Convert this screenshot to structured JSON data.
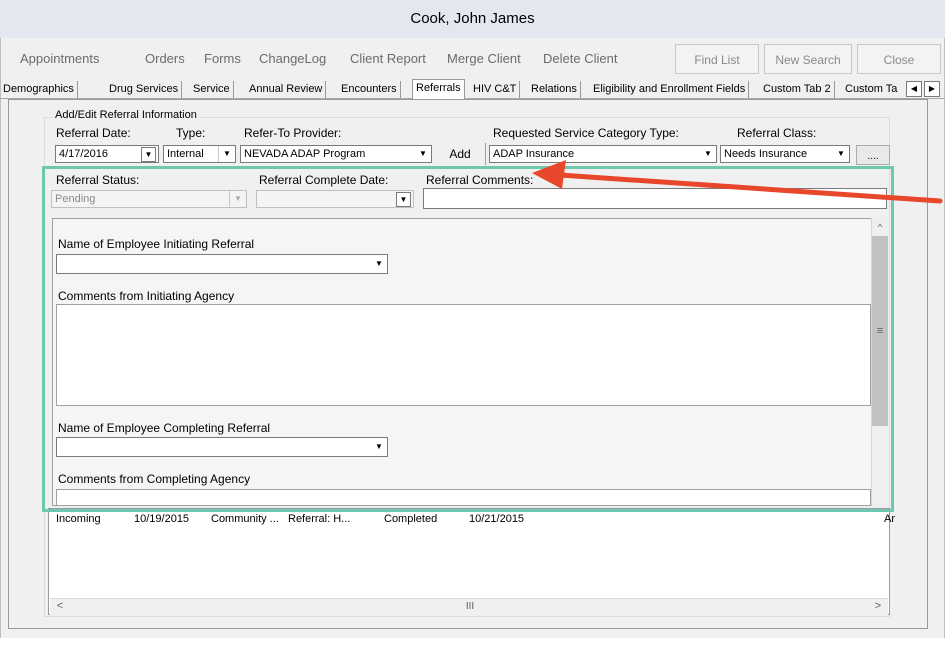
{
  "window": {
    "title": "Cook, John James"
  },
  "toolbar": {
    "items": [
      "Appointments",
      "Orders",
      "Forms",
      "ChangeLog",
      "Client Report",
      "Merge Client",
      "Delete Client"
    ],
    "find_list": "Find List",
    "new_search": "New Search",
    "close": "Close"
  },
  "tabs": [
    "Demographics",
    "Drug Services",
    "Service",
    "Annual Review",
    "Encounters",
    "Referrals",
    "HIV C&T",
    "Relations",
    "Eligibility and Enrollment Fields",
    "Custom Tab 2",
    "Custom Ta"
  ],
  "active_tab": "Referrals",
  "referral": {
    "group_title": "Add/Edit Referral Information",
    "referral_date_label": "Referral Date:",
    "referral_date_value": "4/17/2016",
    "type_label": "Type:",
    "type_value": "Internal",
    "provider_label": "Refer-To Provider:",
    "provider_value": "NEVADA ADAP Program",
    "add_label": "Add",
    "category_label": "Requested Service Category Type:",
    "category_value": "ADAP Insurance",
    "class_label": "Referral Class:",
    "class_value": "Needs Insurance",
    "ellipsis_label": "....",
    "status_label": "Referral Status:",
    "status_value": "Pending",
    "complete_date_label": "Referral Complete Date:",
    "complete_date_value": "",
    "comments_label": "Referral Comments:",
    "employee_initiating_label": "Name of Employee Initiating Referral",
    "comments_initiating_label": "Comments from Initiating Agency",
    "employee_completing_label": "Name of Employee Completing Referral",
    "comments_completing_label": "Comments from Completing Agency"
  },
  "list_row": {
    "direction": "Incoming",
    "date": "10/19/2015",
    "agency": "Community ...",
    "referral": "Referral: H...",
    "status": "Completed",
    "completed_date": "10/21/2015",
    "trailing": "Ar"
  },
  "annotation": {
    "highlight_color": "#6cc9b0",
    "arrow_color": "#e8472c"
  }
}
